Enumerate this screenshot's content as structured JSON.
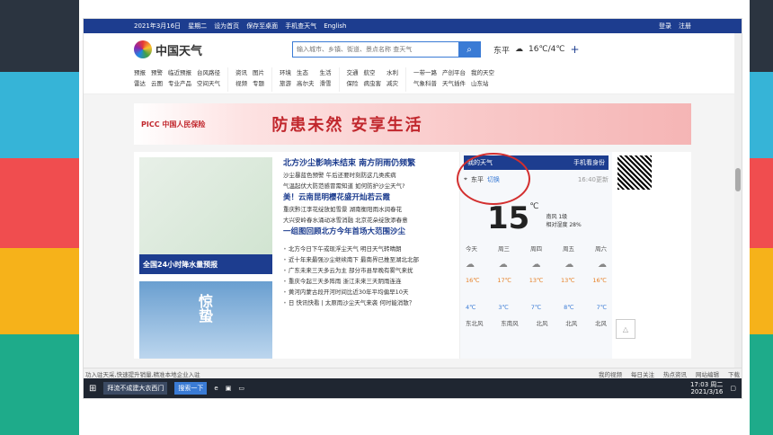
{
  "decor_colors": [
    "#2b3440",
    "#36b4d7",
    "#f04d4f",
    "#f6b21a",
    "#1eab8a"
  ],
  "topbar": {
    "date": "2021年3月16日",
    "weekday": "星期二",
    "links": [
      "设为首页",
      "保存至桌面",
      "手机查天气",
      "English"
    ],
    "login": "登录",
    "register": "注册"
  },
  "header": {
    "logo": "中国天气",
    "search_placeholder": "输入城市、乡镇、街道、景点名称 查天气",
    "city": "东平",
    "temp": "16℃/4℃",
    "add": "+"
  },
  "nav_groups": [
    [
      "预报",
      "预警",
      "临近预报",
      "台风路径",
      "雷达",
      "云图",
      "专业产品",
      "空间天气"
    ],
    [
      "资讯",
      "图片",
      "视频",
      "专题"
    ],
    [
      "环境",
      "生态",
      "生活",
      "旅游",
      "高尔夫",
      "滑雪"
    ],
    [
      "交通",
      "航空",
      "水利",
      "保险",
      "病虫害",
      "减灾"
    ],
    [
      "一带一路",
      "产创平台",
      "我的天空",
      "气象科普",
      "天气插件",
      "山东站"
    ]
  ],
  "banner": {
    "brand": "PICC 中国人民保险",
    "slogan": "防患未然  安享生活"
  },
  "left": {
    "map_caption": "全国24小时降水量预报",
    "img_text": "惊蛰"
  },
  "news": {
    "headline": "北方沙尘影响未结束 南方阴雨仍频繁",
    "line1": "沙尘暴蓝色预警 午后还要时刻防这几类疾病",
    "line2": "气温起伏大防范感冒需知道 如何防护沙尘天气?",
    "headline2": "美！云南昆明樱花盛开灿若云霞",
    "line3": "重庆黔江李花绽放如雪景 湖南衡阳雨水润春花",
    "line4": "大兴安岭春水涌动冰雪消融 北京花朵绽放添春意",
    "headline3": "一组图回顾北方今年首场大范围沙尘",
    "items": [
      "北方今日下午或现浮尘天气 明日天气转晴朗",
      "近十年来最强沙尘继续南下 最南界已推至湖北北部",
      "广东未来三天多云为主 部分市县早晚有雾气来扰",
      "重庆今起三天多阵雨 浙江未来三天阴雨连连",
      "黄河内蒙古段开河时间比近30年平均偏早10天",
      "日 快讯快看 | 太原雨沙尘天气来袭 何时能消散？"
    ]
  },
  "weather": {
    "title": "我的天气",
    "mobile": "手机看身份",
    "city": "东平",
    "tag": "切换",
    "updated": "16:40更新",
    "temp": "15",
    "unit": "℃",
    "wind": "南风 1级",
    "humidity": "相对湿度 28%",
    "days": [
      "今天",
      "周三",
      "周四",
      "周五",
      "周六"
    ],
    "highs": [
      "16℃",
      "17℃",
      "13℃",
      "13℃",
      "16℃"
    ],
    "lows": [
      "4℃",
      "3℃",
      "7℃",
      "8℃",
      "7℃"
    ],
    "winds": [
      "东北风",
      "东南风",
      "北风",
      "北风",
      "北风"
    ]
  },
  "statusbar": {
    "left": "功入驻天采,快速提升销量,精准本地企业入驻",
    "items": [
      "我的视频",
      "每日关注",
      "热点资讯",
      "网站编辑",
      "下载"
    ]
  },
  "taskbar": {
    "app1": "拜流不成建大衣西门",
    "app2": "搜索一下",
    "time": "17:03 周二",
    "date": "2021/3/16"
  }
}
